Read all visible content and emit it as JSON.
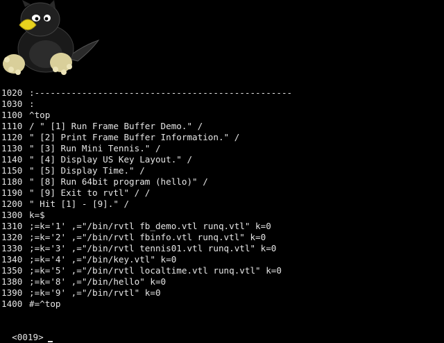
{
  "logo": {
    "icon": "tux-penguin-mascot-icon"
  },
  "program_lines": [
    {
      "num": "1020",
      "code": ":-------------------------------------------------"
    },
    {
      "num": "1030",
      "code": ":"
    },
    {
      "num": "1100",
      "code": "^top"
    },
    {
      "num": "1110",
      "code": "/ \" [1] Run Frame Buffer Demo.\" /"
    },
    {
      "num": "1120",
      "code": "\" [2] Print Frame Buffer Information.\" /"
    },
    {
      "num": "1130",
      "code": "\" [3] Run Mini Tennis.\" /"
    },
    {
      "num": "1140",
      "code": "\" [4] Display US Key Layout.\" /"
    },
    {
      "num": "1150",
      "code": "\" [5] Display Time.\" /"
    },
    {
      "num": "1180",
      "code": "\" [8] Run 64bit program (hello)\" /"
    },
    {
      "num": "1190",
      "code": "\" [9] Exit to rvtl\" / /"
    },
    {
      "num": "1200",
      "code": "\" Hit [1] - [9].\" /"
    },
    {
      "num": "1300",
      "code": "k=$"
    },
    {
      "num": "1310",
      "code": ";=k='1' ,=\"/bin/rvtl fb_demo.vtl runq.vtl\" k=0"
    },
    {
      "num": "1320",
      "code": ";=k='2' ,=\"/bin/rvtl fbinfo.vtl runq.vtl\" k=0"
    },
    {
      "num": "1330",
      "code": ";=k='3' ,=\"/bin/rvtl tennis01.vtl runq.vtl\" k=0"
    },
    {
      "num": "1340",
      "code": ";=k='4' ,=\"/bin/key.vtl\" k=0"
    },
    {
      "num": "1350",
      "code": ";=k='5' ,=\"/bin/rvtl localtime.vtl runq.vtl\" k=0"
    },
    {
      "num": "1380",
      "code": ";=k='8' ,=\"/bin/hello\" k=0"
    },
    {
      "num": "1390",
      "code": ";=k='9' ,=\"/bin/rvtl\" k=0"
    },
    {
      "num": "1400",
      "code": "#=^top"
    }
  ],
  "prompt": {
    "text": "<0019>"
  },
  "colors": {
    "background": "#000000",
    "text": "#e6e6e6"
  }
}
